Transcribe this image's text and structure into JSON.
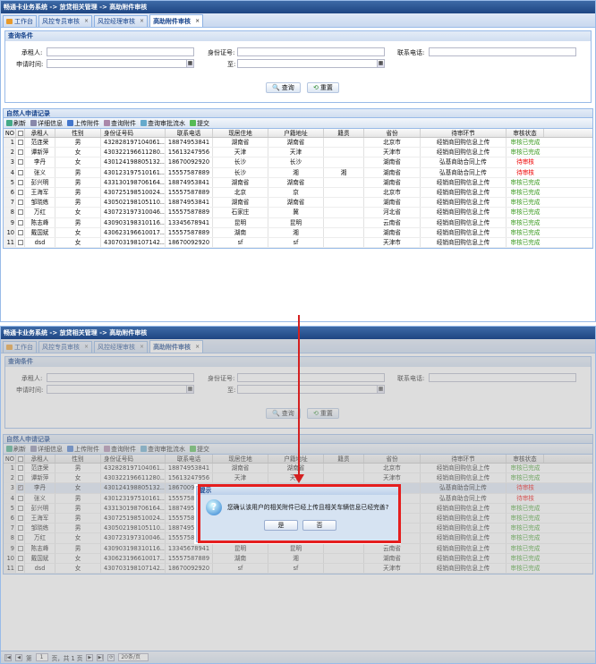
{
  "title": "畅通卡业务系统 -> 放贷相关管理 -> 高助附件审核",
  "tabs": [
    {
      "label": "工作台",
      "closable": false
    },
    {
      "label": "风控专员审核",
      "closable": true
    },
    {
      "label": "风控经理审核",
      "closable": true
    },
    {
      "label": "高助附件审核",
      "closable": true
    }
  ],
  "query": {
    "panel_title": "查询条件",
    "renter_label": "承租人:",
    "id_label": "身份证号:",
    "phone_label": "联系电话:",
    "date_label": "申请时间:",
    "to_label": "至:",
    "search_btn": "查询",
    "reset_btn": "重置"
  },
  "section_title": "自然人申请记录",
  "toolbar": [
    "刷新",
    "详细信息",
    "上传附件",
    "查询附件",
    "查询审批流水",
    "提交"
  ],
  "columns": [
    "NO",
    "",
    "承租人",
    "性别",
    "身份证号码",
    "联系电话",
    "现居住地",
    "户籍地址",
    "籍贯",
    "省份",
    "待审环节",
    "审核状态"
  ],
  "rows": [
    [
      "1",
      "范连荣",
      "男",
      "432828197104061...",
      "18874953841",
      "湖南省",
      "湖南省",
      "",
      "北京市",
      "经销商回购信息上传",
      "审核已完成"
    ],
    [
      "2",
      "谭新萍",
      "女",
      "430322196611280...",
      "15613247956",
      "天津",
      "天津",
      "",
      "天津市",
      "经销商回购信息上传",
      "审核已完成"
    ],
    [
      "3",
      "李丹",
      "女",
      "430124198805132...",
      "18670092920",
      "长沙",
      "长沙",
      "",
      "湖南省",
      "弘基商助合同上传",
      "待审核"
    ],
    [
      "4",
      "张义",
      "男",
      "430123197510161...",
      "15557587889",
      "长沙",
      "湘",
      "湘",
      "湖南省",
      "弘基商助合同上传",
      "待审核"
    ],
    [
      "5",
      "彭兴明",
      "男",
      "433130198706164...",
      "18874953841",
      "湖南省",
      "湖南省",
      "",
      "湖南省",
      "经销商回购信息上传",
      "审核已完成"
    ],
    [
      "6",
      "王海军",
      "男",
      "430725198510024...",
      "15557587889",
      "北京",
      "京",
      "",
      "北京市",
      "经销商回购信息上传",
      "审核已完成"
    ],
    [
      "7",
      "邹晓练",
      "男",
      "430502198105110...",
      "18874953841",
      "湖南省",
      "湖南省",
      "",
      "湖南省",
      "经销商回购信息上传",
      "审核已完成"
    ],
    [
      "8",
      "万红",
      "女",
      "430723197310046...",
      "15557587889",
      "石家庄",
      "冀",
      "",
      "河北省",
      "经销商回购信息上传",
      "审核已完成"
    ],
    [
      "9",
      "陈志峰",
      "男",
      "430903198310116...",
      "13345678941",
      "昆明",
      "昆明",
      "",
      "云南省",
      "经销商回购信息上传",
      "审核已完成"
    ],
    [
      "10",
      "戴国斌",
      "女",
      "430623196610017...",
      "15557587889",
      "湖南",
      "湘",
      "",
      "湖南省",
      "经销商回购信息上传",
      "审核已完成"
    ],
    [
      "11",
      "dsd",
      "女",
      "430703198107142...",
      "18670092920",
      "sf",
      "sf",
      "",
      "天津市",
      "经销商回购信息上传",
      "审核已完成"
    ]
  ],
  "dialog": {
    "title": "提示",
    "message": "您确认该用户的相关附件已经上传且相关车辆信息已经完善?",
    "yes": "是",
    "no": "否"
  },
  "pager": {
    "page_label": "第",
    "page_value": "1",
    "page_of": "页，共 1 页",
    "page_size": "20条/页"
  },
  "colors": {
    "accent": "#15428b",
    "highlight": "#e51e1e",
    "status_ok": "#3a9a1f",
    "status_pending": "#e00"
  }
}
